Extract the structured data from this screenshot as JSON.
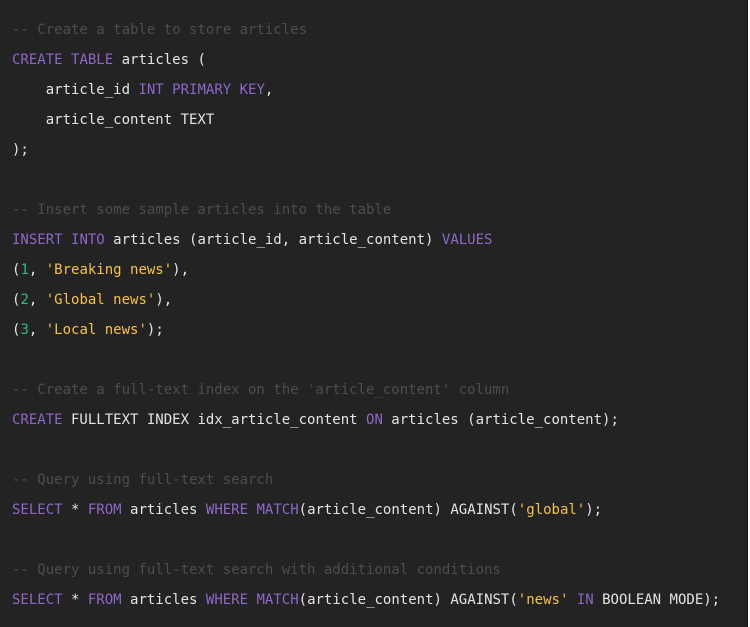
{
  "code": {
    "language": "sql",
    "colors": {
      "background": "#232323",
      "comment": "#4d4d4d",
      "keyword": "#8e67c9",
      "number": "#34ba79",
      "string": "#f6c342",
      "plain": "#e4e4e4"
    },
    "lines": [
      [
        {
          "t": "cm",
          "v": "-- Create a table to store articles"
        }
      ],
      [
        {
          "t": "kw",
          "v": "CREATE"
        },
        {
          "t": "pl",
          "v": " "
        },
        {
          "t": "kw",
          "v": "TABLE"
        },
        {
          "t": "pl",
          "v": " articles ("
        }
      ],
      [
        {
          "t": "pl",
          "v": "    article_id "
        },
        {
          "t": "kw",
          "v": "INT"
        },
        {
          "t": "pl",
          "v": " "
        },
        {
          "t": "kw",
          "v": "PRIMARY"
        },
        {
          "t": "pl",
          "v": " "
        },
        {
          "t": "kw",
          "v": "KEY"
        },
        {
          "t": "pl",
          "v": ","
        }
      ],
      [
        {
          "t": "pl",
          "v": "    article_content TEXT"
        }
      ],
      [
        {
          "t": "pl",
          "v": ");"
        }
      ],
      [],
      [
        {
          "t": "cm",
          "v": "-- Insert some sample articles into the table"
        }
      ],
      [
        {
          "t": "kw",
          "v": "INSERT"
        },
        {
          "t": "pl",
          "v": " "
        },
        {
          "t": "kw",
          "v": "INTO"
        },
        {
          "t": "pl",
          "v": " articles (article_id, article_content) "
        },
        {
          "t": "kw",
          "v": "VALUES"
        }
      ],
      [
        {
          "t": "pl",
          "v": "("
        },
        {
          "t": "num",
          "v": "1"
        },
        {
          "t": "pl",
          "v": ", "
        },
        {
          "t": "str",
          "v": "'Breaking news'"
        },
        {
          "t": "pl",
          "v": "),"
        }
      ],
      [
        {
          "t": "pl",
          "v": "("
        },
        {
          "t": "num",
          "v": "2"
        },
        {
          "t": "pl",
          "v": ", "
        },
        {
          "t": "str",
          "v": "'Global news'"
        },
        {
          "t": "pl",
          "v": "),"
        }
      ],
      [
        {
          "t": "pl",
          "v": "("
        },
        {
          "t": "num",
          "v": "3"
        },
        {
          "t": "pl",
          "v": ", "
        },
        {
          "t": "str",
          "v": "'Local news'"
        },
        {
          "t": "pl",
          "v": ");"
        }
      ],
      [],
      [
        {
          "t": "cm",
          "v": "-- Create a full-text index on the 'article_content' column"
        }
      ],
      [
        {
          "t": "kw",
          "v": "CREATE"
        },
        {
          "t": "pl",
          "v": " FULLTEXT INDEX idx_article_content "
        },
        {
          "t": "kw",
          "v": "ON"
        },
        {
          "t": "pl",
          "v": " articles (article_content);"
        }
      ],
      [],
      [
        {
          "t": "cm",
          "v": "-- Query using full-text search"
        }
      ],
      [
        {
          "t": "kw",
          "v": "SELECT"
        },
        {
          "t": "pl",
          "v": " * "
        },
        {
          "t": "kw",
          "v": "FROM"
        },
        {
          "t": "pl",
          "v": " articles "
        },
        {
          "t": "kw",
          "v": "WHERE"
        },
        {
          "t": "pl",
          "v": " "
        },
        {
          "t": "kw",
          "v": "MATCH"
        },
        {
          "t": "pl",
          "v": "(article_content) AGAINST("
        },
        {
          "t": "str",
          "v": "'global'"
        },
        {
          "t": "pl",
          "v": ");"
        }
      ],
      [],
      [
        {
          "t": "cm",
          "v": "-- Query using full-text search with additional conditions"
        }
      ],
      [
        {
          "t": "kw",
          "v": "SELECT"
        },
        {
          "t": "pl",
          "v": " * "
        },
        {
          "t": "kw",
          "v": "FROM"
        },
        {
          "t": "pl",
          "v": " articles "
        },
        {
          "t": "kw",
          "v": "WHERE"
        },
        {
          "t": "pl",
          "v": " "
        },
        {
          "t": "kw",
          "v": "MATCH"
        },
        {
          "t": "pl",
          "v": "(article_content) AGAINST("
        },
        {
          "t": "str",
          "v": "'news'"
        },
        {
          "t": "pl",
          "v": " "
        },
        {
          "t": "kw",
          "v": "IN"
        },
        {
          "t": "pl",
          "v": " BOOLEAN MODE);"
        }
      ]
    ]
  }
}
